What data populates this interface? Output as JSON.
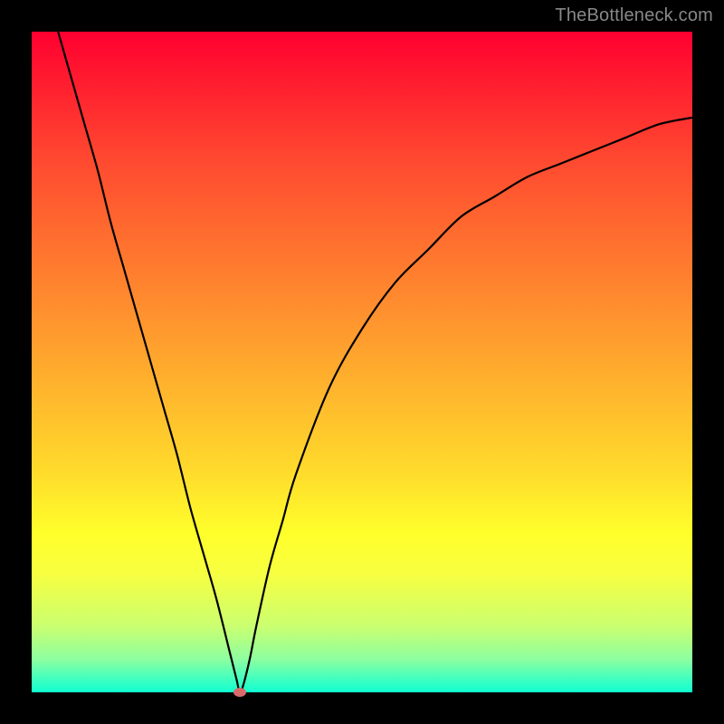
{
  "watermark": "TheBottleneck.com",
  "chart_data": {
    "type": "line",
    "title": "",
    "xlabel": "",
    "ylabel": "",
    "xlim": [
      0,
      100
    ],
    "ylim": [
      0,
      100
    ],
    "grid": false,
    "legend": false,
    "annotations": [],
    "series": [
      {
        "name": "curve",
        "color": "#000000",
        "x": [
          4,
          6,
          8,
          10,
          12,
          14,
          16,
          18,
          20,
          22,
          24,
          26,
          28,
          30,
          31,
          31.5,
          32,
          33,
          34,
          36,
          38,
          40,
          45,
          50,
          55,
          60,
          65,
          70,
          75,
          80,
          85,
          90,
          95,
          100
        ],
        "y": [
          100,
          93,
          86,
          79,
          71,
          64,
          57,
          50,
          43,
          36,
          28,
          21,
          14,
          6,
          2,
          0,
          1,
          5,
          10,
          19,
          26,
          33,
          46,
          55,
          62,
          67,
          72,
          75,
          78,
          80,
          82,
          84,
          86,
          87
        ]
      }
    ],
    "marker": {
      "x": 31.5,
      "y": 0,
      "color": "#d96a6a"
    },
    "background_gradient": {
      "top": "#ff0030",
      "bottom": "#10ffd0",
      "description": "vertical rainbow gradient red→orange→yellow→green"
    }
  }
}
